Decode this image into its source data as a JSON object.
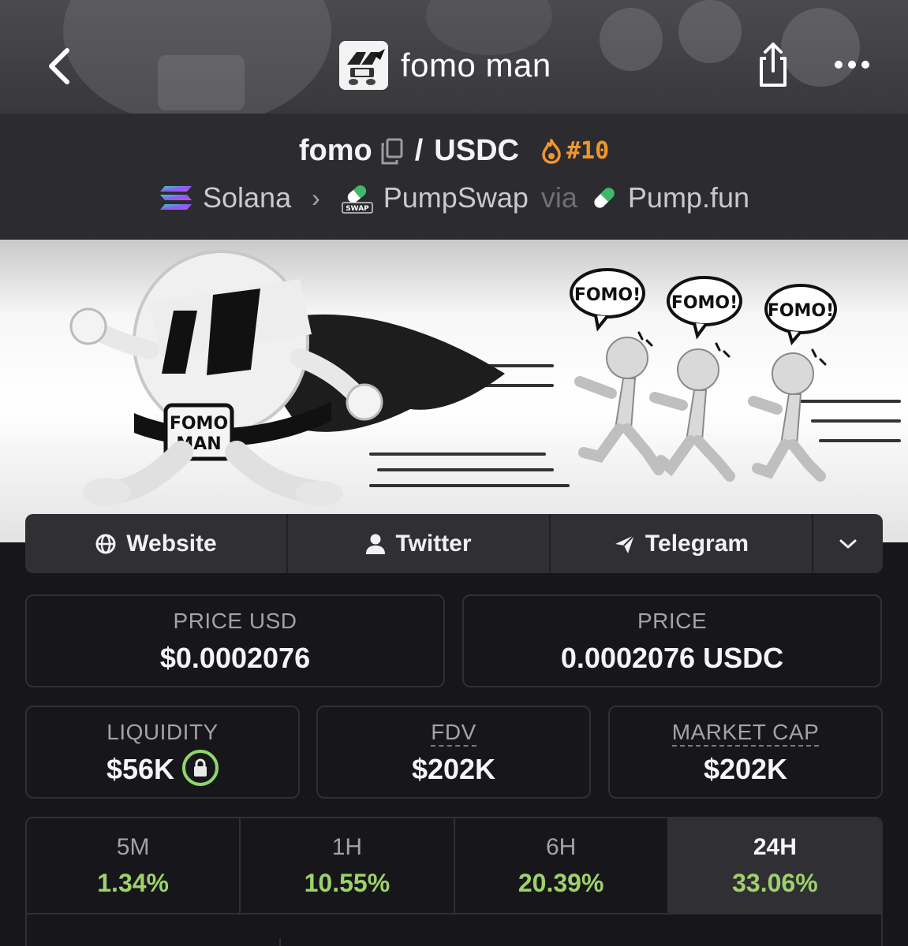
{
  "header": {
    "title": "fomo man",
    "back_icon": "chevron-left-icon",
    "share_icon": "share-icon",
    "more_icon": "more-horizontal-icon"
  },
  "pair": {
    "base": "fomo",
    "separator": "/",
    "quote": "USDC",
    "rank": "#10",
    "copy_icon": "copy-icon",
    "rank_icon": "fire-icon"
  },
  "chain": {
    "network": "Solana",
    "dex": "PumpSwap",
    "dex_badge": "SWAP",
    "via": "via",
    "launchpad": "Pump.fun"
  },
  "banner": {
    "hero_badge_line1": "FOMO",
    "hero_badge_line2": "MAN",
    "bubbles": [
      "FOMO!",
      "FOMO!",
      "FOMO!"
    ]
  },
  "links": {
    "website": "Website",
    "twitter": "Twitter",
    "telegram": "Telegram"
  },
  "stats": {
    "price_usd_label": "PRICE USD",
    "price_usd_value": "$0.0002076",
    "price_label": "PRICE",
    "price_value": "0.0002076 USDC",
    "liquidity_label": "LIQUIDITY",
    "liquidity_value": "$56K",
    "fdv_label": "FDV",
    "fdv_value": "$202K",
    "mcap_label": "MARKET CAP",
    "mcap_value": "$202K"
  },
  "timeframes": [
    {
      "label": "5M",
      "value": "1.34%"
    },
    {
      "label": "1H",
      "value": "10.55%"
    },
    {
      "label": "6H",
      "value": "20.39%"
    },
    {
      "label": "24H",
      "value": "33.06%"
    }
  ],
  "colors": {
    "positive": "#9ed26a",
    "rank": "#f0962e",
    "lock": "#8fd66b"
  }
}
